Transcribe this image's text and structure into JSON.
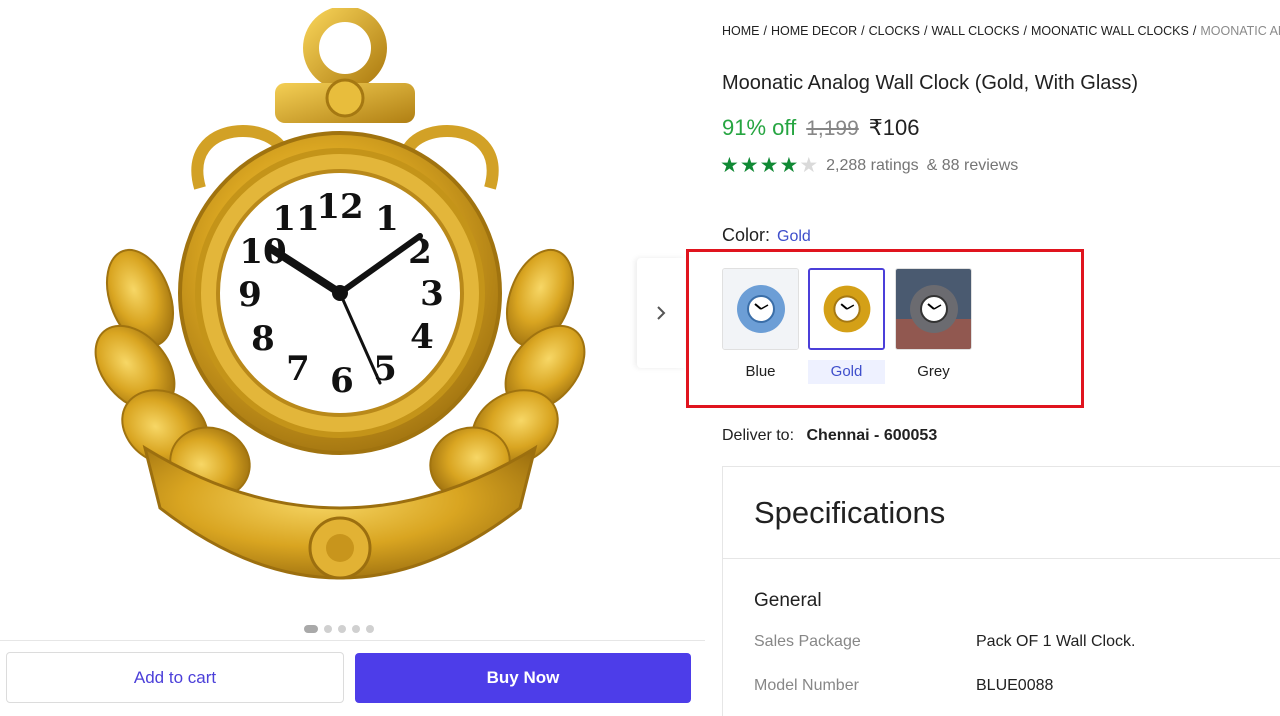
{
  "gallery": {
    "image_alt": "Gold anchor wall clock",
    "clock_numerals": [
      "12",
      "1",
      "2",
      "3",
      "4",
      "5",
      "6",
      "7",
      "8",
      "9",
      "10",
      "11"
    ],
    "dots_count": 5,
    "active_dot": 0,
    "add_to_cart_label": "Add to cart",
    "buy_now_label": "Buy Now"
  },
  "breadcrumb": {
    "items": [
      "HOME",
      "HOME DECOR",
      "CLOCKS",
      "WALL CLOCKS",
      "MOONATIC WALL CLOCKS"
    ],
    "current": "MOONATIC ANALOG WALL CLOCK",
    "separator": "/"
  },
  "product": {
    "title": "Moonatic Analog Wall Clock (Gold, With Glass)",
    "discount": "91% off",
    "mrp": "1,199",
    "price": "₹106",
    "rating_stars": 4,
    "ratings_text": "2,288 ratings",
    "reviews_text": "& 88 reviews"
  },
  "color_picker": {
    "label": "Color:",
    "selected": "Gold",
    "options": [
      {
        "label": "Blue",
        "color": "#6c9ed6"
      },
      {
        "label": "Gold",
        "color": "#d4a017"
      },
      {
        "label": "Grey",
        "color": "#6b6b70"
      }
    ],
    "arrow_icon": "chevron-right-icon"
  },
  "delivery": {
    "label": "Deliver to:",
    "location": "Chennai - 600053"
  },
  "specifications": {
    "title": "Specifications",
    "section": "General",
    "rows": [
      {
        "key": "Sales Package",
        "value": "Pack OF 1 Wall Clock."
      },
      {
        "key": "Model Number",
        "value": "BLUE0088"
      }
    ]
  },
  "colors": {
    "accent": "#4d3de9",
    "discount_green": "#26a541",
    "star_green": "#108934",
    "highlight_red": "#e0141e"
  }
}
